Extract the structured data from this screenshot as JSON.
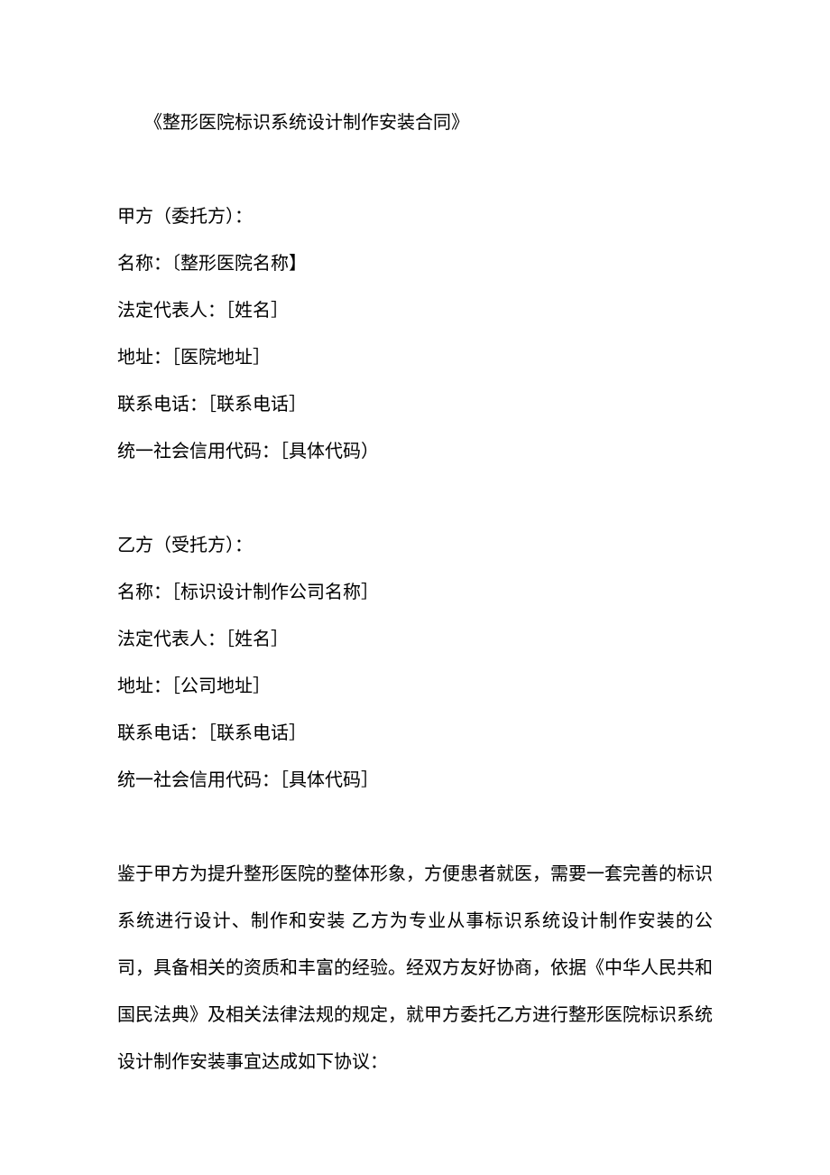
{
  "title": "《整形医院标识系统设计制作安装合同》",
  "partyA": {
    "header": "甲方（委托方）：",
    "name": "名称：〔整形医院名称】",
    "representative": "法定代表人：［姓名］",
    "address": "地址：［医院地址］",
    "phone": "联系电话：［联系电话］",
    "creditCode": "统一社会信用代码：［具体代码）"
  },
  "partyB": {
    "header": "乙方（受托方）：",
    "name": "名称：［标识设计制作公司名称］",
    "representative": "法定代表人：［姓名］",
    "address": "地址：［公司地址］",
    "phone": "联系电话：［联系电话］",
    "creditCode": "统一社会信用代码：［具体代码］"
  },
  "recital": "鉴于甲方为提升整形医院的整体形象，方便患者就医，需要一套完善的标识系统进行设计、制作和安装 乙方为专业从事标识系统设计制作安装的公司，具备相关的资质和丰富的经验。经双方友好协商，依据《中华人民共和国民法典》及相关法律法规的规定，就甲方委托乙方进行整形医院标识系统设计制作安装事宜达成如下协议："
}
